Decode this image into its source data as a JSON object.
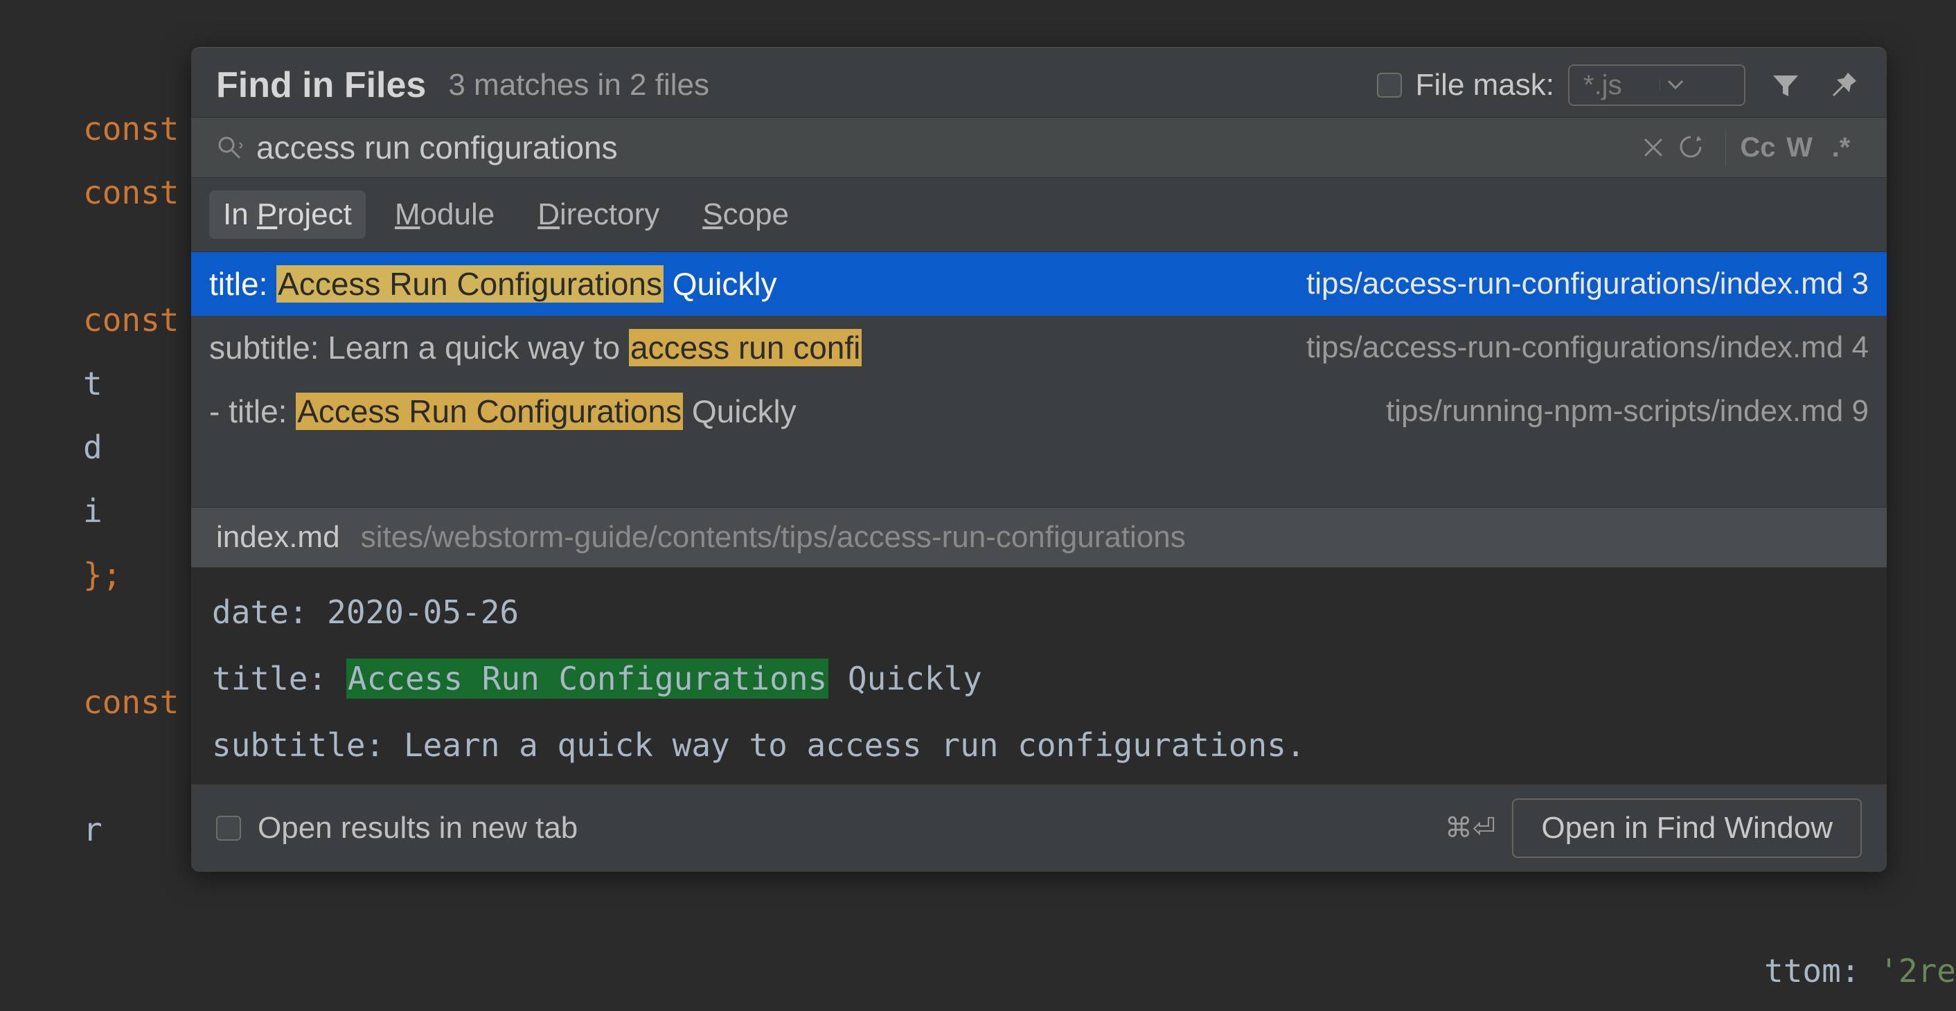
{
  "editor_bg": {
    "l1": "const",
    "l2": "const",
    "l3": "const",
    "l4a": "   t",
    "l4b": "   d",
    "l4c": "   i",
    "l5": "};",
    "l6": "const",
    "l7": "   r",
    "tail_key": "   ttom:",
    "tail_val": " '2re"
  },
  "dialog": {
    "title": "Find in Files",
    "summary": "3 matches in 2 files",
    "file_mask_label": "File mask:",
    "file_mask_value": "*.js"
  },
  "search": {
    "query": "access run configurations",
    "toggles": {
      "cc": "Cc",
      "w": "W",
      "regex": ".*"
    }
  },
  "scope": {
    "in_project_prefix": "In ",
    "in_project_ul": "P",
    "in_project_suffix": "roject",
    "module_ul": "M",
    "module_suffix": "odule",
    "directory_ul": "D",
    "directory_suffix": "irectory",
    "scope_ul": "S",
    "scope_suffix": "cope"
  },
  "results": [
    {
      "pre": "title: ",
      "hl": "Access Run Configurations",
      "post": " Quickly",
      "path": "tips/access-run-configurations/index.md",
      "line": "3",
      "selected": true
    },
    {
      "pre": "subtitle: Learn a quick way to ",
      "hl": "access run confi",
      "post": "",
      "path": "tips/access-run-configurations/index.md",
      "line": "4",
      "selected": false
    },
    {
      "pre": "- title: ",
      "hl": "Access Run Configurations",
      "post": " Quickly",
      "path": "tips/running-npm-scripts/index.md",
      "line": "9",
      "selected": false
    }
  ],
  "preview": {
    "filename": "index.md",
    "filepath": "sites/webstorm-guide/contents/tips/access-run-configurations",
    "l1": "date: 2020-05-26",
    "l2_pre": "title: ",
    "l2_hl": "Access Run Configurations",
    "l2_post": " Quickly",
    "l3": "subtitle: Learn a quick way to access run configurations."
  },
  "footer": {
    "open_in_tab": "Open results in new tab",
    "shortcut": "⌘⏎",
    "open_btn": "Open in Find Window"
  }
}
